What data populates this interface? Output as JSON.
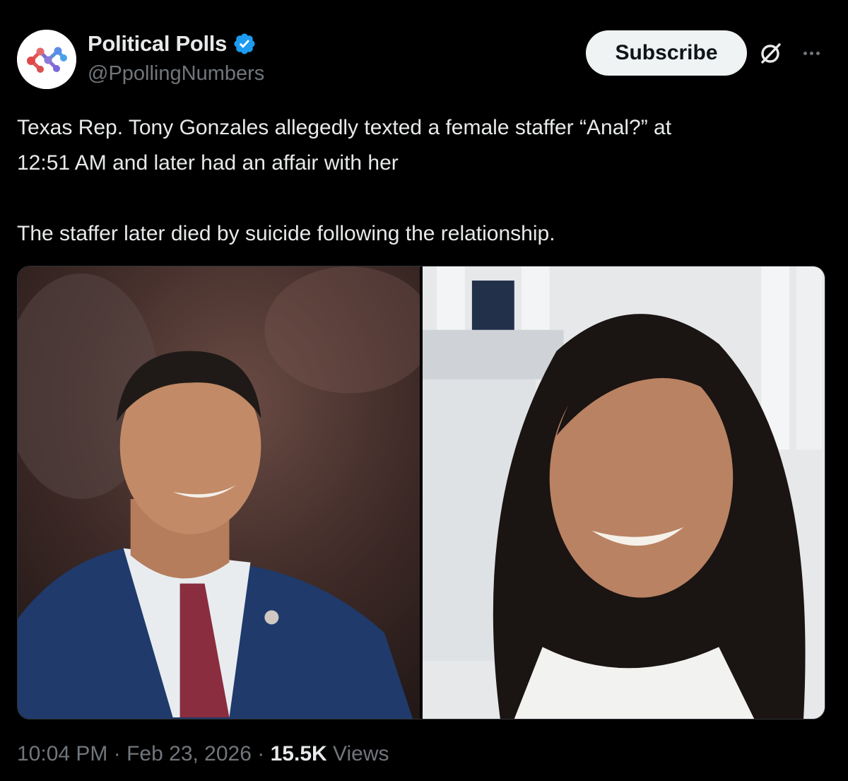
{
  "author": {
    "display_name": "Political Polls",
    "handle": "@PpollingNumbers",
    "verified": true,
    "avatar_icon": "network-dots-logo-icon"
  },
  "actions": {
    "subscribe_label": "Subscribe",
    "grok_icon": "grok-slash-circle-icon",
    "more_icon": "more-horizontal-icon"
  },
  "post": {
    "paragraph_1_line_1": "Texas Rep. Tony Gonzales allegedly texted a female staffer “Anal?” at",
    "paragraph_1_line_2": "12:51 AM and later had an affair with her",
    "paragraph_2": "The staffer later died by suicide following the relationship."
  },
  "media": [
    {
      "name": "photo-man-in-suit"
    },
    {
      "name": "photo-woman-smiling"
    }
  ],
  "meta": {
    "time": "10:04 PM",
    "separator": "·",
    "date": "Feb 23, 2026",
    "views_count": "15.5K",
    "views_label": "Views"
  },
  "colors": {
    "background": "#000000",
    "text_primary": "#e7e9ea",
    "text_secondary": "#71767b",
    "verified_blue": "#1d9bf0",
    "button_bg": "#eff3f4"
  }
}
